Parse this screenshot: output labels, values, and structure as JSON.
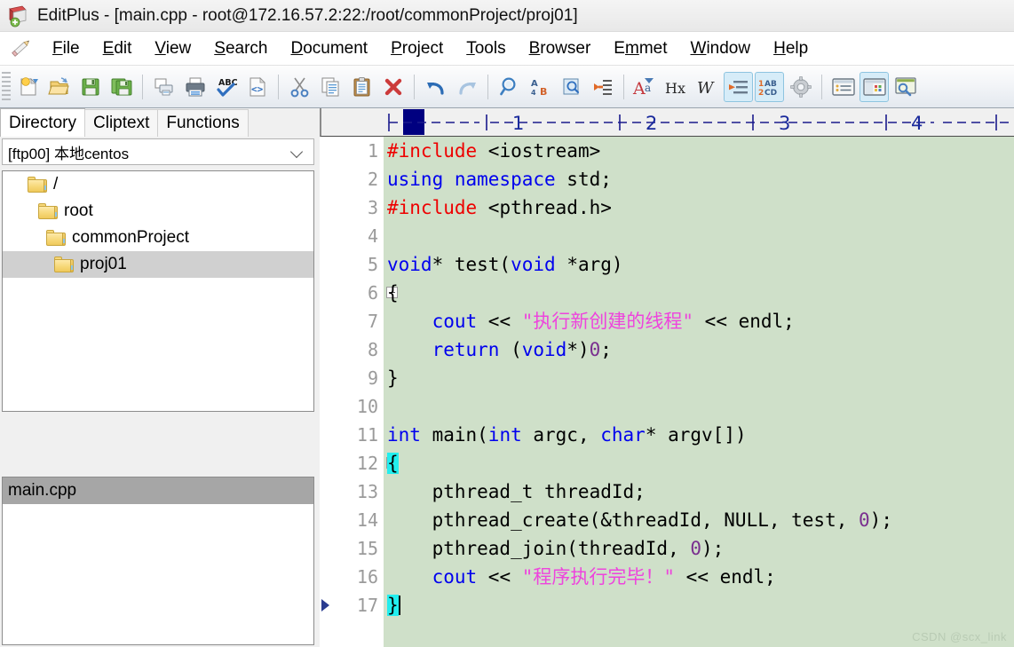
{
  "window": {
    "app_name": "EditPlus",
    "title": "EditPlus - [main.cpp - root@172.16.57.2:22:/root/commonProject/proj01]",
    "icon": "editplus-app-icon"
  },
  "menubar": {
    "pencil_icon": "pencil-icon",
    "items": [
      {
        "label": "File",
        "accel": "F"
      },
      {
        "label": "Edit",
        "accel": "E"
      },
      {
        "label": "View",
        "accel": "V"
      },
      {
        "label": "Search",
        "accel": "S"
      },
      {
        "label": "Document",
        "accel": "D"
      },
      {
        "label": "Project",
        "accel": "P"
      },
      {
        "label": "Tools",
        "accel": "T"
      },
      {
        "label": "Browser",
        "accel": "B"
      },
      {
        "label": "Emmet",
        "accel": "m"
      },
      {
        "label": "Window",
        "accel": "W"
      },
      {
        "label": "Help",
        "accel": "H"
      }
    ]
  },
  "toolbar": {
    "groups": [
      [
        "new-file-icon",
        "open-file-icon",
        "save-icon",
        "save-all-icon"
      ],
      [
        "print-preview-icon",
        "print-icon",
        "spellcheck-icon",
        "view-in-browser-icon"
      ],
      [
        "cut-icon",
        "copy-icon",
        "paste-icon",
        "delete-icon"
      ],
      [
        "undo-icon",
        "redo-icon"
      ],
      [
        "find-icon",
        "replace-icon",
        "find-in-files-icon",
        "goto-line-icon"
      ],
      [
        "font-icon",
        "hex-viewer-icon",
        "word-wrap-icon",
        "indent-icon",
        "line-numbers-icon",
        "preferences-icon"
      ],
      [
        "document-selector-icon",
        "directory-window-icon",
        "output-window-icon"
      ]
    ],
    "active": [
      "indent-icon",
      "line-numbers-icon",
      "directory-window-icon"
    ]
  },
  "sidebar": {
    "tabs": [
      {
        "label": "Directory",
        "selected": true
      },
      {
        "label": "Cliptext",
        "selected": false
      },
      {
        "label": "Functions",
        "selected": false
      }
    ],
    "connection_combo": {
      "value": "[ftp00] 本地centos",
      "chevron": "chevron-down-icon"
    },
    "tree": [
      {
        "label": "/",
        "depth": 0,
        "selected": false
      },
      {
        "label": "root",
        "depth": 1,
        "selected": false
      },
      {
        "label": "commonProject",
        "depth": 2,
        "selected": false
      },
      {
        "label": "proj01",
        "depth": 3,
        "selected": true
      }
    ],
    "files": [
      {
        "label": "main.cpp",
        "selected": true
      }
    ]
  },
  "editor": {
    "background_color": "#cfe0c9",
    "ruler": {
      "marks": [
        "1",
        "2",
        "3",
        "4"
      ],
      "column_indicator_color": "#000080"
    },
    "watermark": "CSDN @scx_link",
    "lines": [
      {
        "n": "1",
        "fold": false,
        "marker": false
      },
      {
        "n": "2",
        "fold": false,
        "marker": false
      },
      {
        "n": "3",
        "fold": false,
        "marker": false
      },
      {
        "n": "4",
        "fold": false,
        "marker": false
      },
      {
        "n": "5",
        "fold": false,
        "marker": false
      },
      {
        "n": "6",
        "fold": true,
        "marker": false
      },
      {
        "n": "7",
        "fold": false,
        "marker": false
      },
      {
        "n": "8",
        "fold": false,
        "marker": false
      },
      {
        "n": "9",
        "fold": false,
        "marker": false
      },
      {
        "n": "10",
        "fold": false,
        "marker": false
      },
      {
        "n": "11",
        "fold": false,
        "marker": false
      },
      {
        "n": "12",
        "fold": true,
        "marker": false
      },
      {
        "n": "13",
        "fold": false,
        "marker": false
      },
      {
        "n": "14",
        "fold": false,
        "marker": false
      },
      {
        "n": "15",
        "fold": false,
        "marker": false
      },
      {
        "n": "16",
        "fold": false,
        "marker": false
      },
      {
        "n": "17",
        "fold": false,
        "marker": true
      }
    ],
    "code_text": [
      "#include <iostream>",
      "using namespace std;",
      "#include <pthread.h>",
      "",
      "void* test(void *arg)",
      "{",
      "    cout << \"执行新创建的线程\" << endl;",
      "    return (void*)0;",
      "}",
      "",
      "int main(int argc, char* argv[])",
      "{",
      "    pthread_t threadId;",
      "    pthread_create(&threadId, NULL, test, 0);",
      "    pthread_join(threadId, 0);",
      "    cout << \"程序执行完毕！\" << endl;",
      "}"
    ],
    "syntax_colors": {
      "preprocessor": "#ee0000",
      "keyword": "#0000ee",
      "string": "#ee44dd",
      "number": "#7a2f8f",
      "plain": "#000000",
      "brace_match_highlight": "#22eeee",
      "line_number": "#9a9a9a"
    }
  }
}
